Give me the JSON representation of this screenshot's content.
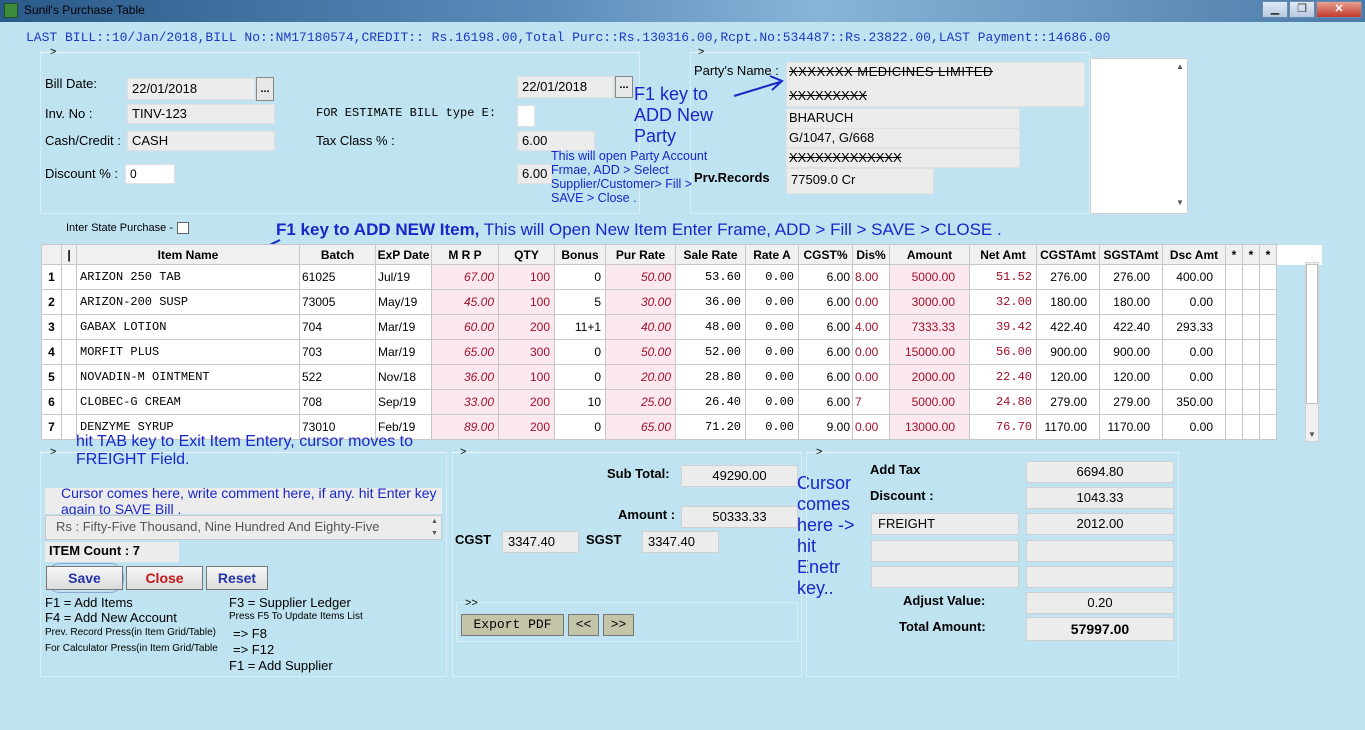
{
  "window": {
    "title": "Sunil's Purchase Table",
    "min": "▁",
    "max": "❐",
    "close": "✕"
  },
  "top_info": "LAST BILL::10/Jan/2018,BILL No::NM17180574,CREDIT:: Rs.16198.00,Total Purc::Rs.130316.00,Rcpt.No:534487::Rs.23822.00,LAST Payment::14686.00",
  "bill": {
    "bill_date_label": "Bill Date:",
    "bill_date": "22/01/2018",
    "date2": "22/01/2018",
    "inv_label": "Inv. No :",
    "inv_no": "TINV-123",
    "estimate_label": "FOR ESTIMATE BILL type E:",
    "cash_label": "Cash/Credit :",
    "cash_value": "CASH",
    "tax_label": "Tax Class % :",
    "tax_value": "6.00",
    "discount_label": "Discount % :",
    "discount_value": "0",
    "tax_value2": "6.00",
    "dots": "..."
  },
  "party": {
    "name_label": "Party's Name :",
    "name": "XXXXXXX MEDICINES LIMITED",
    "line2": "XXXXXXXXX",
    "line3": "BHARUCH",
    "line4": "G/1047, G/668",
    "line5": "XXXXXXXXXXXXX",
    "prv_label": "Prv.Records",
    "prv_value": "77509.0 Cr"
  },
  "inter_state_label": "Inter State Purchase -",
  "annotations": {
    "f1_party": "F1 key to ADD New Party",
    "party_info": "This will open Party Account Frmae, ADD > Select Supplier/Customer> Fill > SAVE > Close .",
    "f1_item_bold": "F1 key to ADD NEW Item,",
    "f1_item_rest": " This will Open New Item Enter Frame, ADD > Fill > SAVE > CLOSE .",
    "tab_hint": "hit TAB key to Exit Item Entery, cursor moves to FREIGHT Field.",
    "tab_hint_bold": "TAB",
    "comment_hint": "Cursor comes here, write comment here, if any. hit Enter key again to SAVE Bill .",
    "cursor_hint": "Cursor comes here -> hit Enetr key.."
  },
  "grid": {
    "headers": [
      "",
      "|",
      "Item Name",
      "Batch",
      "ExP Date",
      "M R P",
      "QTY",
      "Bonus",
      "Pur Rate",
      "Sale Rate",
      "Rate A",
      "CGST%",
      "Dis%",
      "Amount",
      "Net Amt",
      "CGSTAmt",
      "SGSTAmt",
      "Dsc Amt",
      "*",
      "*",
      "*"
    ],
    "rows": [
      {
        "no": "1",
        "name": "ARIZON 250 TAB",
        "batch": "61025",
        "exp": "Jul/19",
        "mrp": "67.00",
        "qty": "100",
        "bonus": "0",
        "pur": "50.00",
        "sale": "53.60",
        "ratea": "0.00",
        "cgst": "6.00",
        "dis": "8.00",
        "amount": "5000.00",
        "net": "51.52",
        "camt": "276.00",
        "samt": "276.00",
        "damt": "400.00"
      },
      {
        "no": "2",
        "name": "ARIZON-200 SUSP",
        "batch": "73005",
        "exp": "May/19",
        "mrp": "45.00",
        "qty": "100",
        "bonus": "5",
        "pur": "30.00",
        "sale": "36.00",
        "ratea": "0.00",
        "cgst": "6.00",
        "dis": "0.00",
        "amount": "3000.00",
        "net": "32.00",
        "camt": "180.00",
        "samt": "180.00",
        "damt": "0.00"
      },
      {
        "no": "3",
        "name": "GABAX LOTION",
        "batch": "704",
        "exp": "Mar/19",
        "mrp": "60.00",
        "qty": "200",
        "bonus": "11+1",
        "pur": "40.00",
        "sale": "48.00",
        "ratea": "0.00",
        "cgst": "6.00",
        "dis": "4.00",
        "amount": "7333.33",
        "net": "39.42",
        "camt": "422.40",
        "samt": "422.40",
        "damt": "293.33"
      },
      {
        "no": "4",
        "name": "MORFIT PLUS",
        "batch": "703",
        "exp": "Mar/19",
        "mrp": "65.00",
        "qty": "300",
        "bonus": "0",
        "pur": "50.00",
        "sale": "52.00",
        "ratea": "0.00",
        "cgst": "6.00",
        "dis": "0.00",
        "amount": "15000.00",
        "net": "56.00",
        "camt": "900.00",
        "samt": "900.00",
        "damt": "0.00"
      },
      {
        "no": "5",
        "name": "NOVADIN-M OINTMENT",
        "batch": "522",
        "exp": "Nov/18",
        "mrp": "36.00",
        "qty": "100",
        "bonus": "0",
        "pur": "20.00",
        "sale": "28.80",
        "ratea": "0.00",
        "cgst": "6.00",
        "dis": "0.00",
        "amount": "2000.00",
        "net": "22.40",
        "camt": "120.00",
        "samt": "120.00",
        "damt": "0.00"
      },
      {
        "no": "6",
        "name": "CLOBEC-G CREAM",
        "batch": "708",
        "exp": "Sep/19",
        "mrp": "33.00",
        "qty": "200",
        "bonus": "10",
        "pur": "25.00",
        "sale": "26.40",
        "ratea": "0.00",
        "cgst": "6.00",
        "dis": "7",
        "amount": "5000.00",
        "net": "24.80",
        "camt": "279.00",
        "samt": "279.00",
        "damt": "350.00"
      },
      {
        "no": "7",
        "name": "DENZYME SYRUP",
        "batch": "73010",
        "exp": "Feb/19",
        "mrp": "89.00",
        "qty": "200",
        "bonus": "0",
        "pur": "65.00",
        "sale": "71.20",
        "ratea": "0.00",
        "cgst": "9.00",
        "dis": "0.00",
        "amount": "13000.00",
        "net": "76.70",
        "camt": "1170.00",
        "samt": "1170.00",
        "damt": "0.00"
      }
    ]
  },
  "footer_left": {
    "words": "Rs : Fifty-Five Thousand, Nine Hundred And Eighty-Five",
    "item_count": "ITEM Count : 7",
    "save": "Save",
    "close": "Close",
    "reset": "Reset",
    "k1": "F1 = Add Items",
    "k2": "F3 = Supplier Ledger",
    "k3": "F4 = Add New Account",
    "k4": "Press F5 To Update Items List",
    "k5": "Prev. Record Press(in Item Grid/Table)",
    "k6": "=> F8",
    "k7": "For Calculator Press(in Item Grid/Table",
    "k8": "=> F12",
    "k9": "F1 = Add Supplier"
  },
  "footer_mid": {
    "subtotal_label": "Sub Total:",
    "subtotal": "49290.00",
    "amount_label": "Amount :",
    "amount": "50333.33",
    "cgst_label": "CGST",
    "cgst": "3347.40",
    "sgst_label": "SGST",
    "sgst": "3347.40",
    "arrows": ">>",
    "export": "Export PDF",
    "prev": "<<",
    "next": ">>"
  },
  "footer_right": {
    "addtax_label": "Add Tax",
    "addtax": "6694.80",
    "discount_label": "Discount :",
    "discount": "1043.33",
    "freight_label": "FREIGHT",
    "freight": "2012.00",
    "adjust_label": "Adjust Value:",
    "adjust": "0.20",
    "total_label": "Total Amount:",
    "total": "57997.00"
  },
  "colors": {
    "accent": "#1a26c8",
    "value_red": "#a0102a",
    "bg": "#bfe3f0"
  }
}
